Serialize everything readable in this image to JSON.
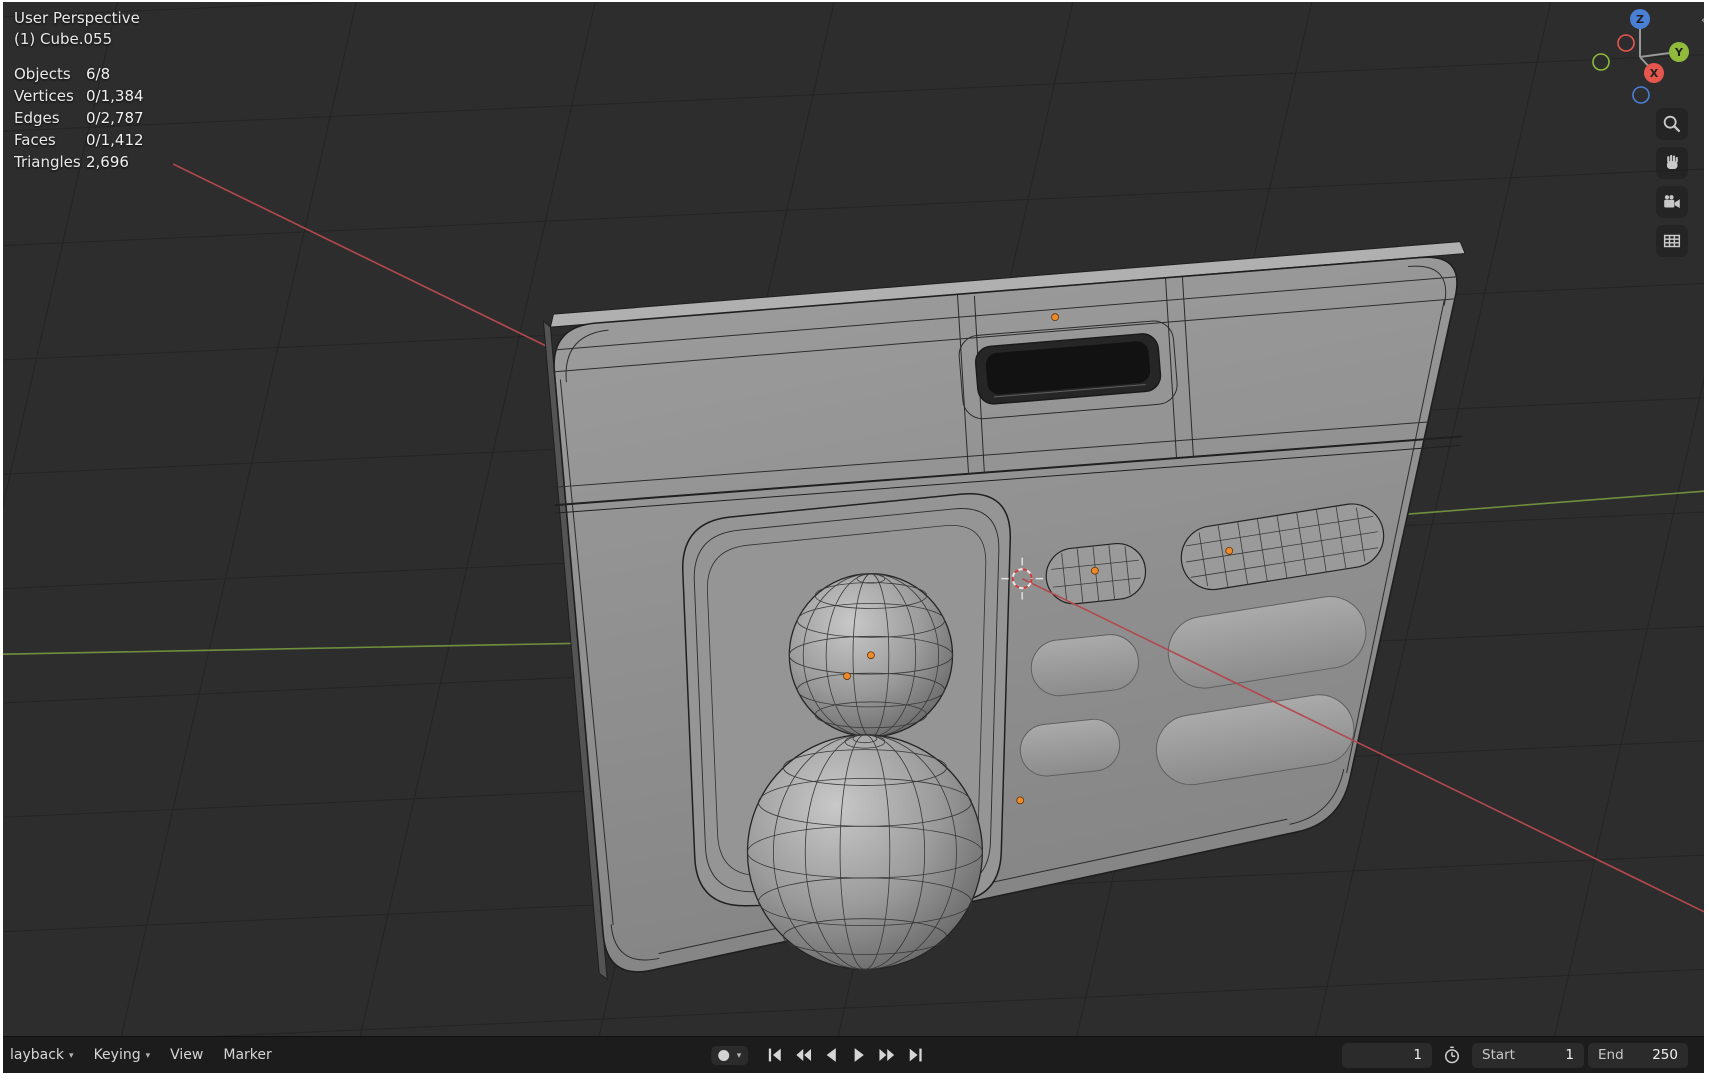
{
  "viewport": {
    "header": {
      "view_label": "User Perspective",
      "object_label": "(1) Cube.055"
    },
    "stats": {
      "rows": [
        {
          "label": "Objects",
          "value": "6/8"
        },
        {
          "label": "Vertices",
          "value": "0/1,384"
        },
        {
          "label": "Edges",
          "value": "0/2,787"
        },
        {
          "label": "Faces",
          "value": "0/1,412"
        },
        {
          "label": "Triangles",
          "value": "2,696"
        }
      ]
    },
    "gizmo": {
      "x_label": "X",
      "y_label": "Y",
      "z_label": "Z"
    },
    "nav_icon_names": [
      "zoom-icon",
      "pan-hand-icon",
      "camera-view-icon",
      "grid-ortho-icon"
    ],
    "colors": {
      "background": "#2d2d2d",
      "axis_x": "#b3494f",
      "axis_y": "#6f8f3e",
      "gizmo_x": "#e5574d",
      "gizmo_y": "#8fba3c",
      "gizmo_z": "#4a7fd6",
      "origin_dot": "#ee8a2b",
      "mesh_gray": "#939393"
    }
  },
  "icons": {
    "menu_chevron": "▾",
    "area_corner": "‹"
  },
  "timeline": {
    "menus": [
      {
        "label": "layback"
      },
      {
        "label": "Keying"
      },
      {
        "label": "View"
      },
      {
        "label": "Marker"
      }
    ],
    "frame_current": "1",
    "start_label": "Start",
    "start_value": "1",
    "end_label": "End",
    "end_value": "250"
  }
}
